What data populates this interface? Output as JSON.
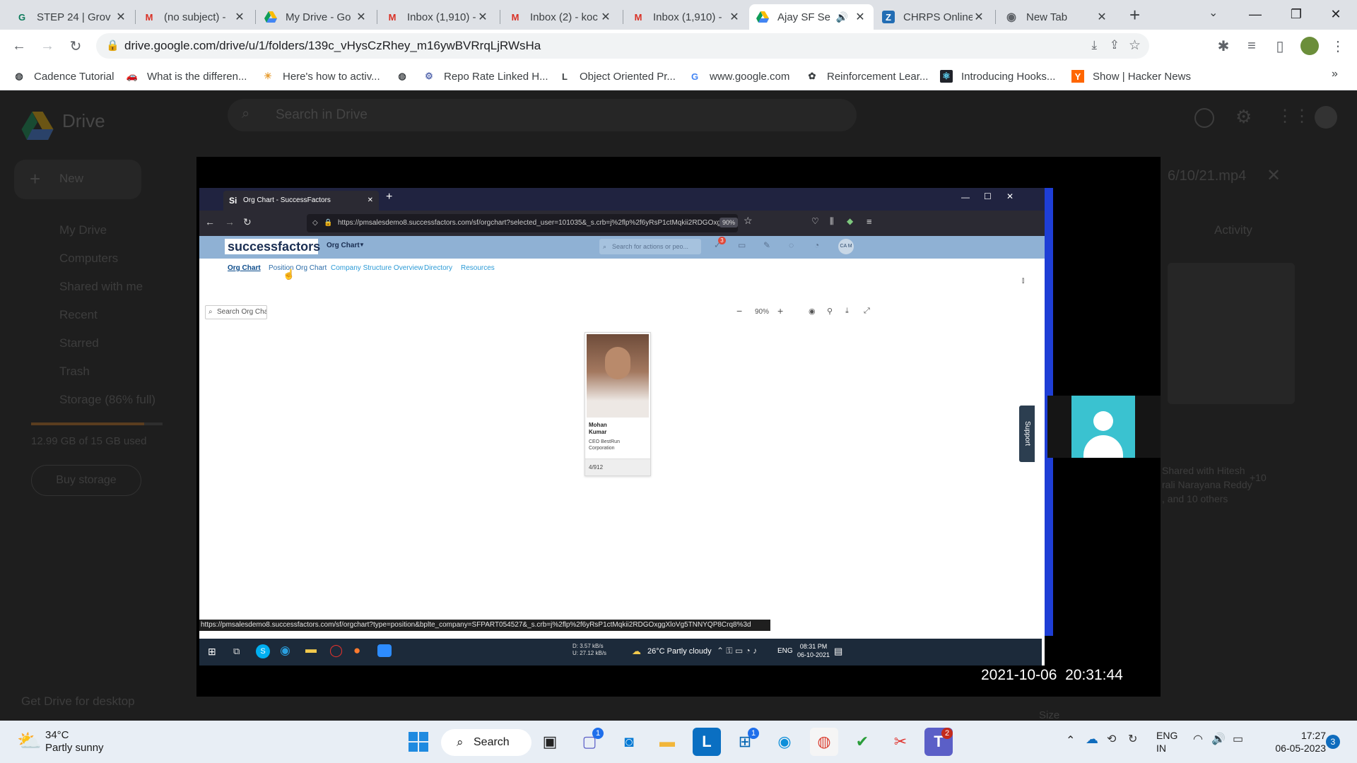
{
  "browser": {
    "tabs": [
      {
        "title": "STEP 24 | Grov",
        "icon": "grow-icon",
        "active": false
      },
      {
        "title": "(no subject) - ",
        "icon": "gmail-icon",
        "active": false
      },
      {
        "title": "My Drive - Go",
        "icon": "drive-icon",
        "active": false
      },
      {
        "title": "Inbox (1,910) -",
        "icon": "gmail-icon",
        "active": false
      },
      {
        "title": "Inbox (2) - koc",
        "icon": "gmail-icon",
        "active": false
      },
      {
        "title": "Inbox (1,910) -",
        "icon": "gmail-icon",
        "active": false
      },
      {
        "title": "Ajay SF Se",
        "icon": "drive-icon",
        "active": true
      },
      {
        "title": "CHRPS Online",
        "icon": "zoho-icon",
        "active": false
      },
      {
        "title": "New Tab",
        "icon": "chrome-icon",
        "active": false
      }
    ],
    "url": "drive.google.com/drive/u/1/folders/139c_vHysCzRhey_m16ywBVRrqLjRWsHa",
    "bookmarks": [
      {
        "label": "Cadence Tutorial",
        "icon": "globe-icon"
      },
      {
        "label": "What is the differen...",
        "icon": "car-icon"
      },
      {
        "label": "Here's how to activ...",
        "icon": "sun-icon"
      },
      {
        "label": "",
        "icon": "globe-icon"
      },
      {
        "label": "Repo Rate Linked H...",
        "icon": "gear-icon"
      },
      {
        "label": "Object Oriented Pr...",
        "icon": "L-icon"
      },
      {
        "label": "www.google.com",
        "icon": "google-icon"
      },
      {
        "label": "Reinforcement Lear...",
        "icon": "openai-icon"
      },
      {
        "label": "Introducing Hooks...",
        "icon": "react-icon"
      },
      {
        "label": "Show | Hacker News",
        "icon": "hn-icon"
      }
    ]
  },
  "drive": {
    "logo_text": "Drive",
    "search_placeholder": "Search in Drive",
    "new_label": "New",
    "sidebar": [
      "My Drive",
      "Computers",
      "Shared with me",
      "Recent",
      "Starred",
      "Trash",
      "Storage (86% full)"
    ],
    "storage_used": "12.99 GB of 15 GB used",
    "storage_fraction": 0.86,
    "buy_storage": "Buy storage",
    "get_desktop": "Get Drive for desktop",
    "file_title": "6/10/21.mp4",
    "activity_label": "Activity",
    "shared_text_1": "Shared with Hitesh",
    "shared_text_2": "rali Narayana Reddy",
    "shared_text_3": ", and 10 others",
    "avatar_count": "+10",
    "size_label": "Size"
  },
  "video": {
    "timestamp": "2021-10-06  20:31:44",
    "inner_tab_title": "Org Chart - SuccessFactors",
    "inner_url": "https://pmsalesdemo8.successfactors.com/sf/orgchart?selected_user=101035&_s.crb=j%2flp%2f6yRsP1ctMqkii2RDGOxg",
    "inner_zoom": "90%",
    "sf_logo": "successfactors",
    "sf_module": "Org Chart",
    "sf_search_placeholder": "Search for actions or peo...",
    "sf_notification_count": "3",
    "sf_user": "CA M",
    "sf_nav": [
      "Org Chart",
      "Position Org Chart",
      "Company Structure Overview",
      "Directory",
      "Resources"
    ],
    "search_org_chart": "Search Org Chart",
    "chart_zoom": "90%",
    "card_name_1": "Mohan",
    "card_name_2": "Kumar",
    "card_title_1": "CEO BestRun",
    "card_title_2": "Corporation",
    "card_count": "4/912",
    "support_label": "Support",
    "status_url": "https://pmsalesdemo8.successfactors.com/sf/orgchart?type=position&bplte_company=SFPART054527&_s.crb=j%2flp%2f6yRsP1ctMqkii2RDGOxggXloVg5TNNYQP8Crq8%3d",
    "inner_net_down": "3.57 kB/s",
    "inner_net_up": "27.12 kB/s",
    "inner_net_d_label": "D:",
    "inner_net_u_label": "U:",
    "inner_weather": "26°C  Partly cloudy",
    "inner_lang": "ENG",
    "inner_time": "08:31 PM",
    "inner_date": "06-10-2021"
  },
  "taskbar": {
    "weather_temp": "34°C",
    "weather_desc": "Partly sunny",
    "search_label": "Search",
    "lang_1": "ENG",
    "lang_2": "IN",
    "time": "17:27",
    "date": "06-05-2023",
    "notif_count": "3",
    "chat_badge": "1",
    "store_badge": "1",
    "teams_badge": "2"
  }
}
